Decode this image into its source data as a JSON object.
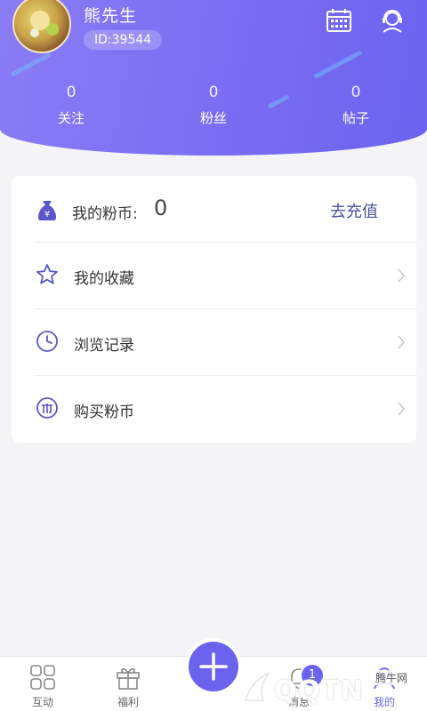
{
  "profile": {
    "name": "熊先生",
    "id_text": "ID:39544"
  },
  "stats": [
    {
      "value": "0",
      "label": "关注"
    },
    {
      "value": "0",
      "label": "粉丝"
    },
    {
      "value": "0",
      "label": "帖子"
    }
  ],
  "balance": {
    "label": "我的粉币:",
    "value": "0",
    "action": "去充值"
  },
  "menu": [
    {
      "label": "我的收藏",
      "icon": "star-icon"
    },
    {
      "label": "浏览记录",
      "icon": "clock-icon"
    },
    {
      "label": "购买粉币",
      "icon": "coin-icon"
    }
  ],
  "tabs": [
    {
      "label": "互动",
      "icon": "grid-icon"
    },
    {
      "label": "福利",
      "icon": "gift-icon"
    },
    {
      "label": "消息",
      "icon": "bell-icon"
    },
    {
      "label": "我的",
      "icon": "user-icon"
    }
  ],
  "message_badge": "1",
  "watermark": {
    "brand": "QQTN",
    "site": "腾牛网"
  },
  "colors": {
    "accent": "#6b63ee",
    "header_gradient_start": "#8a7cf5",
    "header_gradient_end": "#6a63ef",
    "link": "#4a4f9e"
  }
}
